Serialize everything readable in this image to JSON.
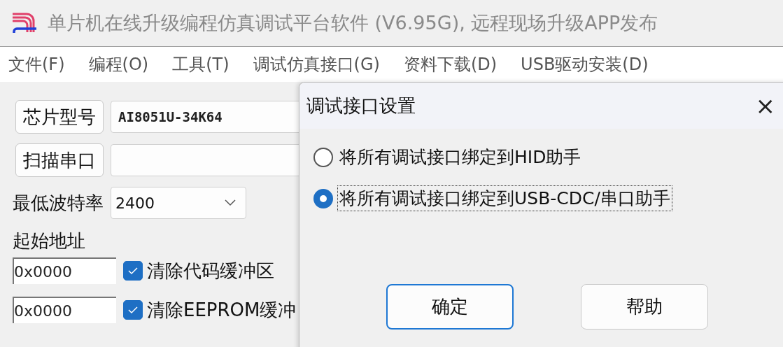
{
  "window": {
    "title": "单片机在线升级编程仿真调试平台软件 (V6.95G), 远程现场升级APP发布"
  },
  "menu": [
    "文件(F)",
    "编程(O)",
    "工具(T)",
    "调试仿真接口(G)",
    "资料下载(D)",
    "USB驱动安装(D)"
  ],
  "chip": {
    "button": "芯片型号",
    "value": "AI8051U-34K64"
  },
  "port": {
    "button": "扫描串口"
  },
  "baud": {
    "label": "最低波特率",
    "value": "2400"
  },
  "start_address": {
    "label": "起始地址"
  },
  "address_rows": [
    {
      "value": "0x0000",
      "checked": true,
      "label": "清除代码缓冲区"
    },
    {
      "value": "0x0000",
      "checked": true,
      "label": "清除EEPROM缓冲"
    }
  ],
  "dialog": {
    "title": "调试接口设置",
    "close": "×",
    "options": [
      {
        "label": "将所有调试接口绑定到HID助手",
        "selected": false
      },
      {
        "label": "将所有调试接口绑定到USB-CDC/串口助手",
        "selected": true
      }
    ],
    "buttons": [
      {
        "label": "确定",
        "default": true
      },
      {
        "label": "帮助",
        "default": false
      }
    ]
  }
}
